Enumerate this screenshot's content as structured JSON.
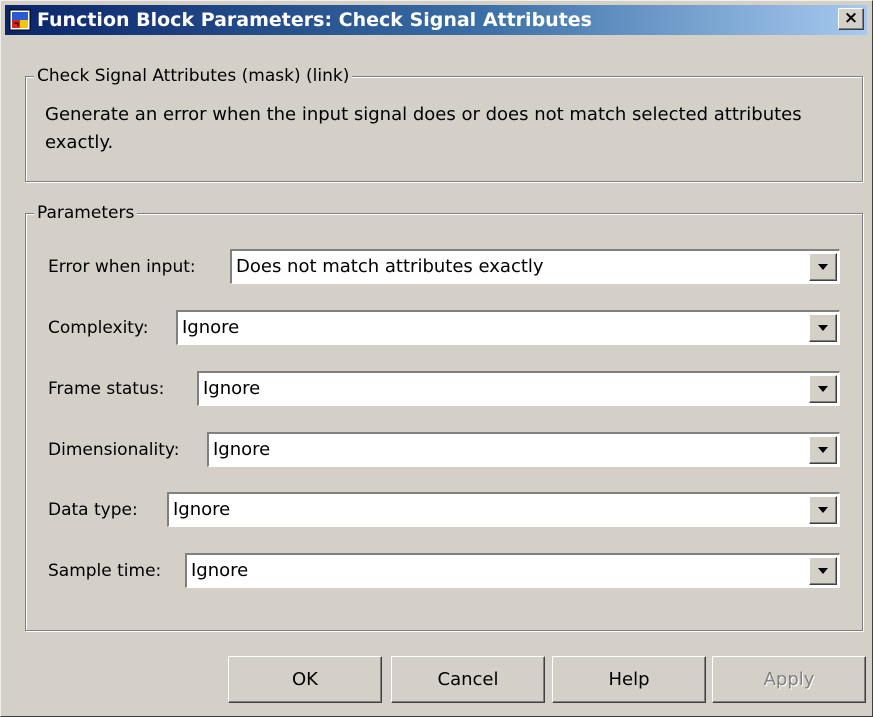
{
  "window": {
    "title": "Function Block Parameters: Check Signal Attributes",
    "close_label": "×"
  },
  "colors": {
    "titlebar_start": "#0a246a",
    "titlebar_end": "#a6caf0",
    "face": "#d4d0c8"
  },
  "description_group": {
    "legend": "Check Signal Attributes (mask) (link)",
    "text": "Generate an error when the input signal does or does not match selected attributes exactly."
  },
  "parameters_group": {
    "legend": "Parameters",
    "rows": [
      {
        "label": "Error when input:",
        "value": "Does not match attributes exactly"
      },
      {
        "label": "Complexity:",
        "value": "Ignore"
      },
      {
        "label": "Frame status:",
        "value": "Ignore"
      },
      {
        "label": "Dimensionality:",
        "value": "Ignore"
      },
      {
        "label": "Data type:",
        "value": "Ignore"
      },
      {
        "label": "Sample time:",
        "value": "Ignore"
      }
    ]
  },
  "buttons": {
    "ok": "OK",
    "cancel": "Cancel",
    "help": "Help",
    "apply": "Apply"
  },
  "icons": {
    "title_icon": "simulink-block-icon",
    "dropdown_arrow": "chevron-down-icon"
  }
}
